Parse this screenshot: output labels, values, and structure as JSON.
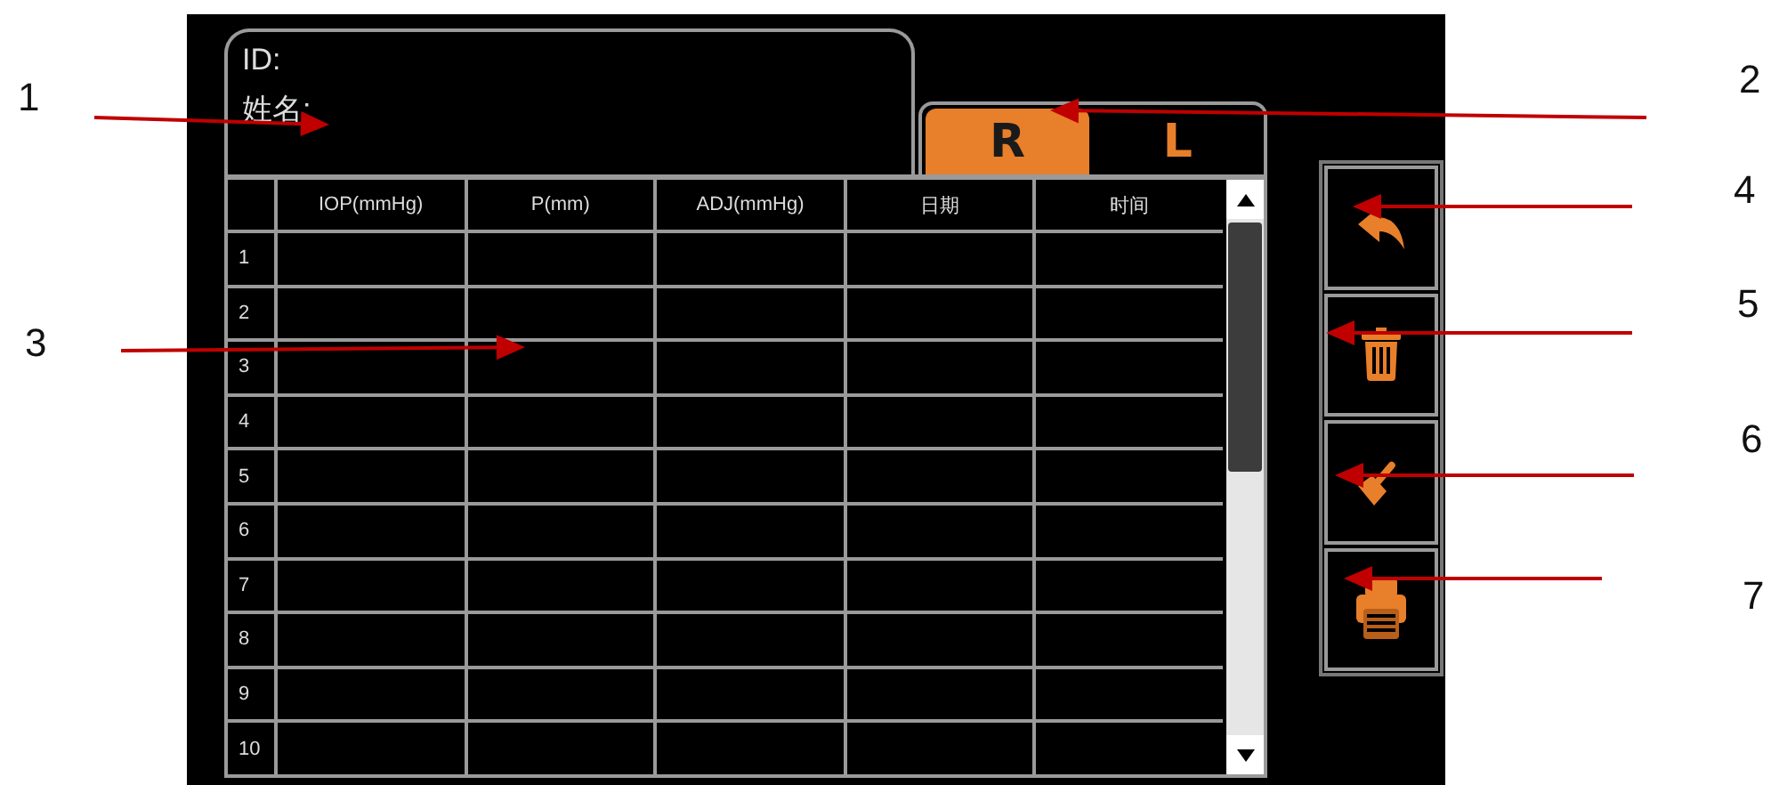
{
  "patient": {
    "id_label": "ID:",
    "name_label": "姓名:"
  },
  "tabs": [
    {
      "label": "R",
      "selected": true
    },
    {
      "label": "L",
      "selected": false
    }
  ],
  "table": {
    "columns": [
      "IOP(mmHg)",
      "P(mm)",
      "ADJ(mmHg)",
      "日期",
      "时间"
    ],
    "rows": [
      {
        "number": "1"
      },
      {
        "number": "2"
      },
      {
        "number": "3"
      },
      {
        "number": "4"
      },
      {
        "number": "5"
      },
      {
        "number": "6"
      },
      {
        "number": "7"
      },
      {
        "number": "8"
      },
      {
        "number": "9"
      },
      {
        "number": "10"
      }
    ]
  },
  "buttons": [
    {
      "kind": "back"
    },
    {
      "kind": "delete"
    },
    {
      "kind": "clear"
    },
    {
      "kind": "print"
    }
  ],
  "annotations": [
    {
      "label": "1"
    },
    {
      "label": "3"
    },
    {
      "label": "2"
    },
    {
      "label": "4"
    },
    {
      "label": "5"
    },
    {
      "label": "6"
    },
    {
      "label": "7"
    }
  ]
}
